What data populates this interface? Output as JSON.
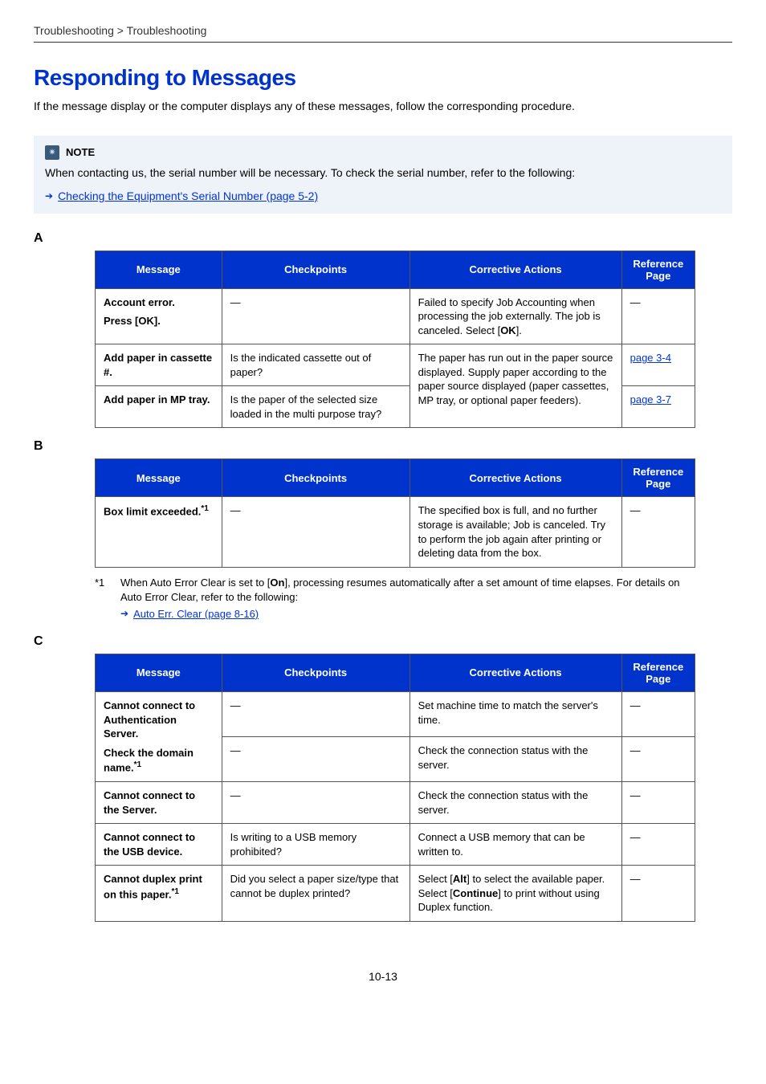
{
  "breadcrumb": "Troubleshooting > Troubleshooting",
  "title": "Responding to Messages",
  "intro": "If the message display or the computer displays any of these messages, follow the corresponding procedure.",
  "note": {
    "label": "NOTE",
    "body": "When contacting us, the serial number will be necessary. To check the serial number, refer to the following:",
    "link": "Checking the Equipment's Serial Number (page 5-2)"
  },
  "headers": {
    "msg": "Message",
    "chk": "Checkpoints",
    "act": "Corrective Actions",
    "ref": "Reference Page"
  },
  "sectA": {
    "letter": "A",
    "rows": [
      {
        "msg_l1": "Account error.",
        "msg_l2": "Press [OK].",
        "chk": "—",
        "act": "Failed to specify Job Accounting when processing the job externally. The job is canceled. Select [",
        "act_bold": "OK",
        "act_after": "].",
        "ref": "—",
        "refLink": false
      },
      {
        "msg_l1": "Add paper in cassette #.",
        "chk": "Is the indicated cassette out of paper?",
        "act": "The paper has run out in the paper source displayed. Supply paper according to the paper source",
        "ref": "page 3-4",
        "refLink": true
      },
      {
        "msg_l1": "Add paper in MP tray.",
        "chk": "Is the paper of the selected size loaded in the multi purpose tray?",
        "act": "displayed (paper cassettes, MP tray, or optional paper feeders).",
        "ref": "page 3-7",
        "refLink": true
      }
    ]
  },
  "sectB": {
    "letter": "B",
    "rows": [
      {
        "msg": "Box limit exceeded.",
        "sup": "*1",
        "chk": "—",
        "act": "The specified box is full, and no further storage is available; Job is canceled. Try to perform the job again after printing or deleting data from the box.",
        "ref": "—"
      }
    ],
    "footnote_mark": "*1",
    "footnote_body_a": "When Auto Error Clear is set to [",
    "footnote_bold": "On",
    "footnote_body_b": "], processing resumes automatically after a set amount of time elapses. For details on Auto Error Clear, refer to the following:",
    "footnote_link": "Auto Err. Clear (page 8-16)"
  },
  "sectC": {
    "letter": "C",
    "rows": [
      {
        "msg_l1": "Cannot connect to Authentication Server.",
        "msg_l2": "Check the domain name.",
        "sup": "*1",
        "chk1": "—",
        "act1": "Set machine time to match the server's time.",
        "ref1": "—",
        "chk2": "—",
        "act2": "Check the connection status with the server.",
        "ref2": "—"
      },
      {
        "msg": "Cannot connect to the Server.",
        "chk": "—",
        "act": "Check the connection status with the server.",
        "ref": "—"
      },
      {
        "msg": "Cannot connect to the USB device.",
        "chk": "Is writing to a USB memory prohibited?",
        "act": "Connect a USB memory that can be written to.",
        "ref": "—"
      },
      {
        "msg": "Cannot duplex print on this paper.",
        "sup": "*1",
        "chk": "Did you select a paper size/type that cannot be duplex printed?",
        "act_a": "Select [",
        "act_b1": "Alt",
        "act_b": "] to select the available paper. Select [",
        "act_b2": "Continue",
        "act_c": "] to print without using Duplex function.",
        "ref": "—"
      }
    ]
  },
  "pagenum": "10-13"
}
